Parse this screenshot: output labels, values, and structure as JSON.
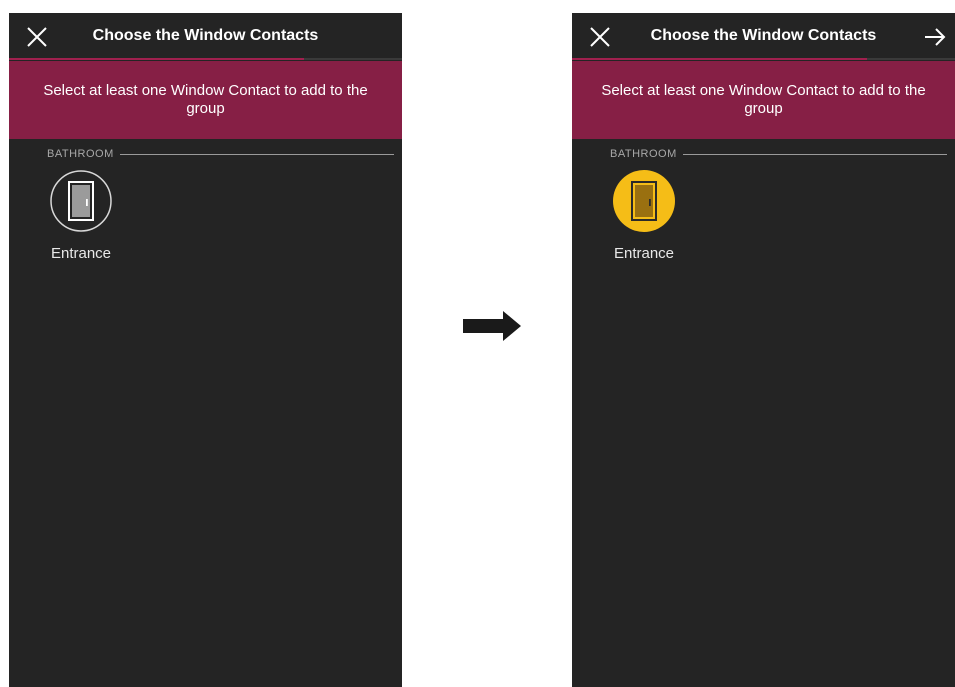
{
  "screens": [
    {
      "state": "unselected",
      "title": "Choose the Window Contacts",
      "banner": "Select at least one Window Contact to add to the group",
      "section": "BATHROOM",
      "device": {
        "name": "Entrance",
        "icon": "door-icon",
        "selected": false
      },
      "next_visible": false,
      "progress": 0.75
    },
    {
      "state": "selected",
      "title": "Choose the Window Contacts",
      "banner": "Select at least one Window Contact to add to the group",
      "section": "BATHROOM",
      "device": {
        "name": "Entrance",
        "icon": "door-icon",
        "selected": true
      },
      "next_visible": true,
      "progress": 0.77
    }
  ],
  "colors": {
    "background": "#242424",
    "banner": "#861f45",
    "accent": "#a0204e",
    "selected": "#f5bd17"
  },
  "transition_arrow_icon": "arrow-right-icon"
}
